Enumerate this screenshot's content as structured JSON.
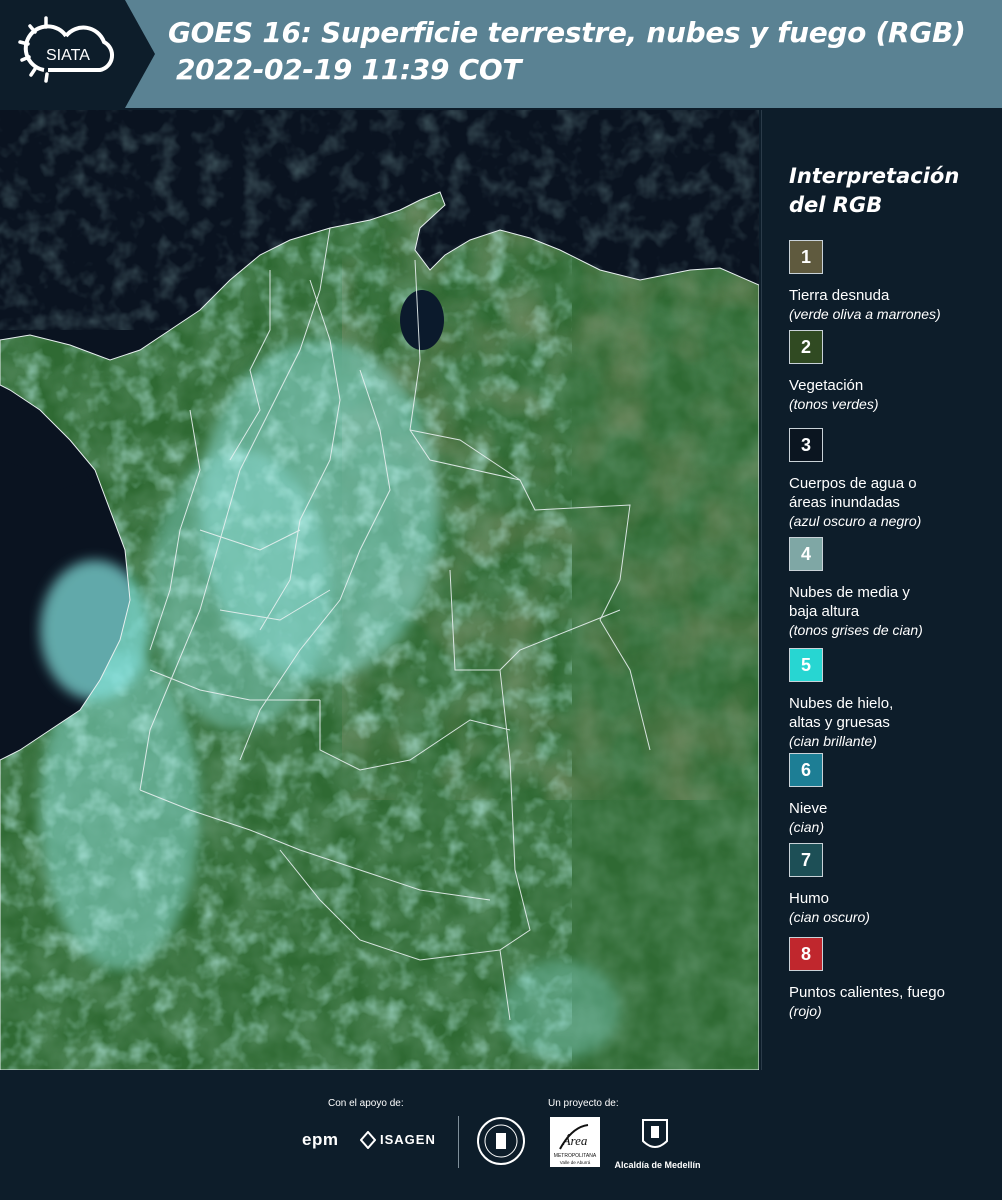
{
  "header": {
    "logo_text": "SIATA",
    "title_line1": "GOES 16: Superficie terrestre, nubes y fuego (RGB)",
    "title_line2": "2022-02-19 11:39 COT",
    "background_color": "#5a8293",
    "logo_background_color": "#0d1d2a"
  },
  "legend": {
    "title_line1": "Interpretación",
    "title_line2": "del RGB",
    "items": [
      {
        "number": "1",
        "label_lines": [
          "Tierra desnuda"
        ],
        "desc": "(verde oliva a marrones)",
        "color": "#5f5a3e"
      },
      {
        "number": "2",
        "label_lines": [
          "Vegetación"
        ],
        "desc": "(tonos verdes)",
        "color": "#304a22"
      },
      {
        "number": "3",
        "label_lines": [
          "Cuerpos de agua o",
          "áreas inundadas"
        ],
        "desc": "(azul oscuro a negro)",
        "color": "#0b1520"
      },
      {
        "number": "4",
        "label_lines": [
          "Nubes de media y",
          "baja altura"
        ],
        "desc": "(tonos grises de cian)",
        "color": "#7fa7a5"
      },
      {
        "number": "5",
        "label_lines": [
          "Nubes de hielo,",
          "altas y gruesas"
        ],
        "desc": "(cian brillante)",
        "color": "#27d6d2"
      },
      {
        "number": "6",
        "label_lines": [
          "Nieve"
        ],
        "desc": "(cian)",
        "color": "#1d7e95"
      },
      {
        "number": "7",
        "label_lines": [
          "Humo"
        ],
        "desc": "(cian oscuro)",
        "color": "#1d4f56"
      },
      {
        "number": "8",
        "label_lines": [
          "Puntos calientes, fuego"
        ],
        "desc": "(rojo)",
        "color": "#c0272d"
      }
    ]
  },
  "footer": {
    "support_label": "Con el apoyo de:",
    "project_label": "Un proyecto de:",
    "sponsor_1": "epm",
    "sponsor_2": "ISAGEN",
    "partner_area_line1": "METROPOLITANA",
    "partner_area_line2": "Valle de Aburrá",
    "partner_alcaldia": "Alcaldía de Medellín"
  },
  "map": {
    "colors": {
      "vegetation": "#2f6a33",
      "dark_vegetation": "#1e4d25",
      "ocean": "#0a1320",
      "cloud_ice": "#7ee0dc",
      "cloud_low": "#9fc9c5",
      "border": "#e8f0f0"
    }
  }
}
